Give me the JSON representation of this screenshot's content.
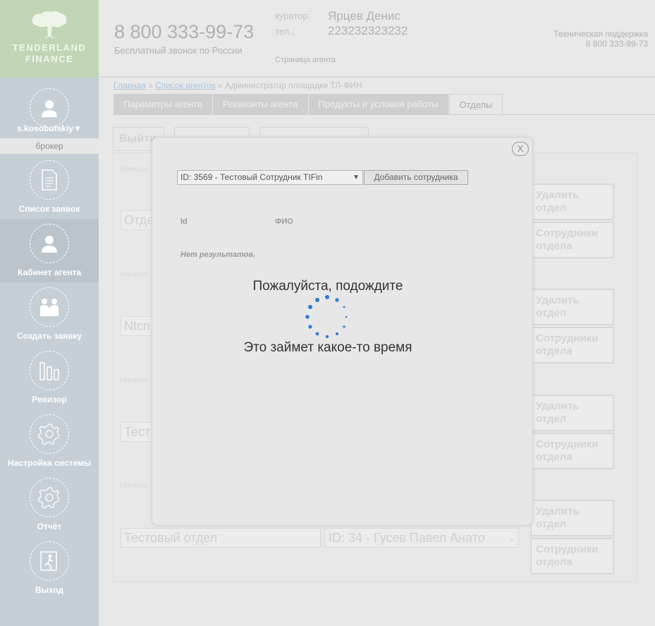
{
  "logo": {
    "line1": "TENDERLAND",
    "line2": "FINANCE"
  },
  "user": {
    "name": "s.kosobutskiy▼",
    "role": "брокер"
  },
  "sidebar": {
    "items": [
      {
        "label": "Список заявок",
        "icon": "document-icon"
      },
      {
        "label": "Кабинет агента",
        "icon": "person-icon",
        "active": true
      },
      {
        "label": "Создать заявку",
        "icon": "handshake-icon"
      },
      {
        "label": "Ревизор",
        "icon": "bar-chart-icon"
      },
      {
        "label": "Настройка системы",
        "icon": "gear-icon"
      },
      {
        "label": "Отчёт",
        "icon": "gear-icon"
      },
      {
        "label": "Выход",
        "icon": "exit-icon"
      }
    ]
  },
  "header": {
    "phone": "8 800 333-99-73",
    "phone_sub": "Бесплатный звонок по России",
    "curator_label": "куратор:",
    "curator_value": "Ярцев Денис",
    "tel_label": "тел.:",
    "tel_value": "223232323232",
    "page_caption": "Страница агента",
    "support_title": "Техническая поддержка",
    "support_phone": "8 800 333-99-73"
  },
  "breadcrumb": {
    "home": "Главная",
    "sep": "»",
    "agents": "Список агентов",
    "current": "Администратор площадки ТЛ-ФИН"
  },
  "tabs": [
    "Параметры агента",
    "Реквизиты агента",
    "Продукты и условия работы",
    "Отделы"
  ],
  "background": {
    "exit_btn": "Выйти",
    "row_label": "Наимен",
    "rows": [
      {
        "input": "Отде"
      },
      {
        "input": "Ntcn"
      },
      {
        "input": "Тест"
      }
    ],
    "delete_label": "Удалить отдел",
    "staff_label": "Сотрудники отдела",
    "last_input": "Тестовый отдел",
    "last_select": "ID: 34 - Гусев Павел Анато"
  },
  "modal": {
    "close": "X",
    "employee_select": "ID: 3569 - Тестовый Сотрудник TIFin",
    "add_button": "Добавить сотрудника",
    "col_id": "Id",
    "col_fio": "ФИО",
    "no_results": "Нет результатов.",
    "wait_title": "Пожалуйста, подождите",
    "wait_sub": "Это займет какое-то время"
  },
  "colors": {
    "logo_bg": "#c2d6b7",
    "sidebar_bg": "#c6cfd6",
    "spinner": "#2c7ed1"
  }
}
